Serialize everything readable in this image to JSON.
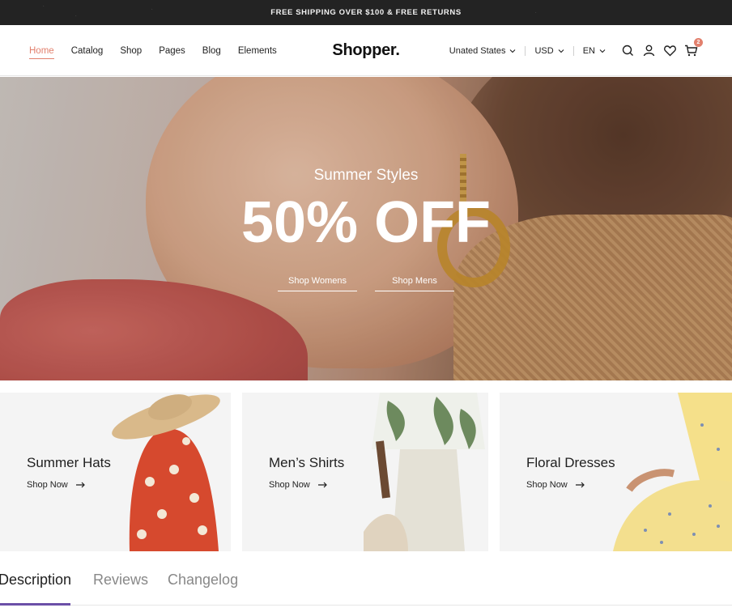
{
  "topbar": {
    "text": "FREE SHIPPING OVER $100 & FREE RETURNS"
  },
  "header": {
    "logo": "Shopper.",
    "nav": [
      {
        "label": "Home",
        "active": true
      },
      {
        "label": "Catalog",
        "active": false
      },
      {
        "label": "Shop",
        "active": false
      },
      {
        "label": "Pages",
        "active": false
      },
      {
        "label": "Blog",
        "active": false
      },
      {
        "label": "Elements",
        "active": false
      }
    ],
    "country": "Unated States",
    "currency": "USD",
    "language": "EN",
    "cart_count": "2",
    "icons": [
      "search-icon",
      "user-icon",
      "heart-icon",
      "cart-icon"
    ]
  },
  "hero": {
    "subtitle": "Summer Styles",
    "title": "50% OFF",
    "link_women": "Shop Womens",
    "link_men": "Shop Mens"
  },
  "cards": [
    {
      "title": "Summer Hats",
      "link": "Shop Now"
    },
    {
      "title": "Men’s Shirts",
      "link": "Shop Now"
    },
    {
      "title": "Floral Dresses",
      "link": "Shop Now"
    }
  ],
  "tabs": [
    {
      "label": "Description",
      "active": true
    },
    {
      "label": "Reviews",
      "active": false
    },
    {
      "label": "Changelog",
      "active": false
    }
  ],
  "colors": {
    "accent": "#e2806d",
    "topbar_bg": "#232323",
    "tab_underline": "#6b4fa7"
  }
}
